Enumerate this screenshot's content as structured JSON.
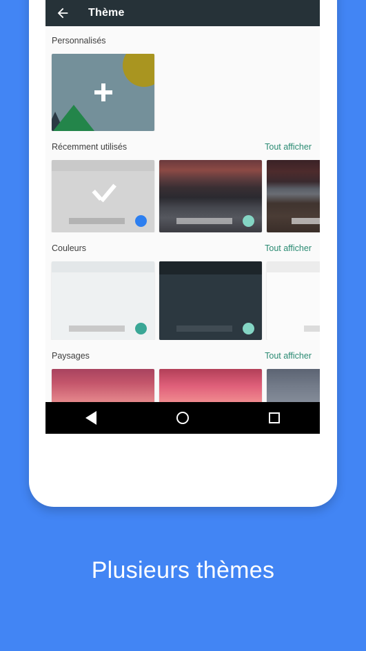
{
  "caption": "Plusieurs thèmes",
  "appbar": {
    "back_icon": "arrow-left-icon",
    "title": "Thème",
    "background": "#263238"
  },
  "accent_colors": {
    "page_background": "#4285f4",
    "link_teal": "#2a8a72",
    "selected_blue": "#2d7ff0",
    "teal_dot": "#3aa796",
    "light_teal_dot": "#84d5c4"
  },
  "sections": [
    {
      "title": "Personnalisés",
      "see_all": null,
      "cards": [
        {
          "name": "add-custom-theme",
          "kind": "custom-add",
          "icon": "plus-icon"
        }
      ]
    },
    {
      "title": "Récemment utilisés",
      "see_all": "Tout afficher",
      "cards": [
        {
          "name": "recent-theme-selected",
          "kind": "selected-gray",
          "icon": "check-icon",
          "dot": "#2d7ff0"
        },
        {
          "name": "recent-theme-dusk-forest",
          "kind": "photo-dusk-forest",
          "dot": "#84d5c4"
        },
        {
          "name": "recent-theme-beach",
          "kind": "photo-beach",
          "dot": null
        }
      ]
    },
    {
      "title": "Couleurs",
      "see_all": "Tout afficher",
      "cards": [
        {
          "name": "color-theme-light",
          "kind": "light",
          "dot": "#3aa796"
        },
        {
          "name": "color-theme-dark",
          "kind": "dark",
          "dot": "#84d5c4"
        },
        {
          "name": "color-theme-white",
          "kind": "white",
          "dot": null
        }
      ]
    },
    {
      "title": "Paysages",
      "see_all": "Tout afficher",
      "cards": [
        {
          "name": "landscape-theme-sunset-hills",
          "kind": "photo-sunset-1",
          "dot": null
        },
        {
          "name": "landscape-theme-sunset-trees",
          "kind": "photo-sunset-2",
          "dot": null
        },
        {
          "name": "landscape-theme-storm-clouds",
          "kind": "photo-storm",
          "dot": null
        }
      ]
    }
  ],
  "navbar": {
    "back": "back-triangle-icon",
    "home": "home-circle-icon",
    "recents": "recents-square-icon"
  }
}
